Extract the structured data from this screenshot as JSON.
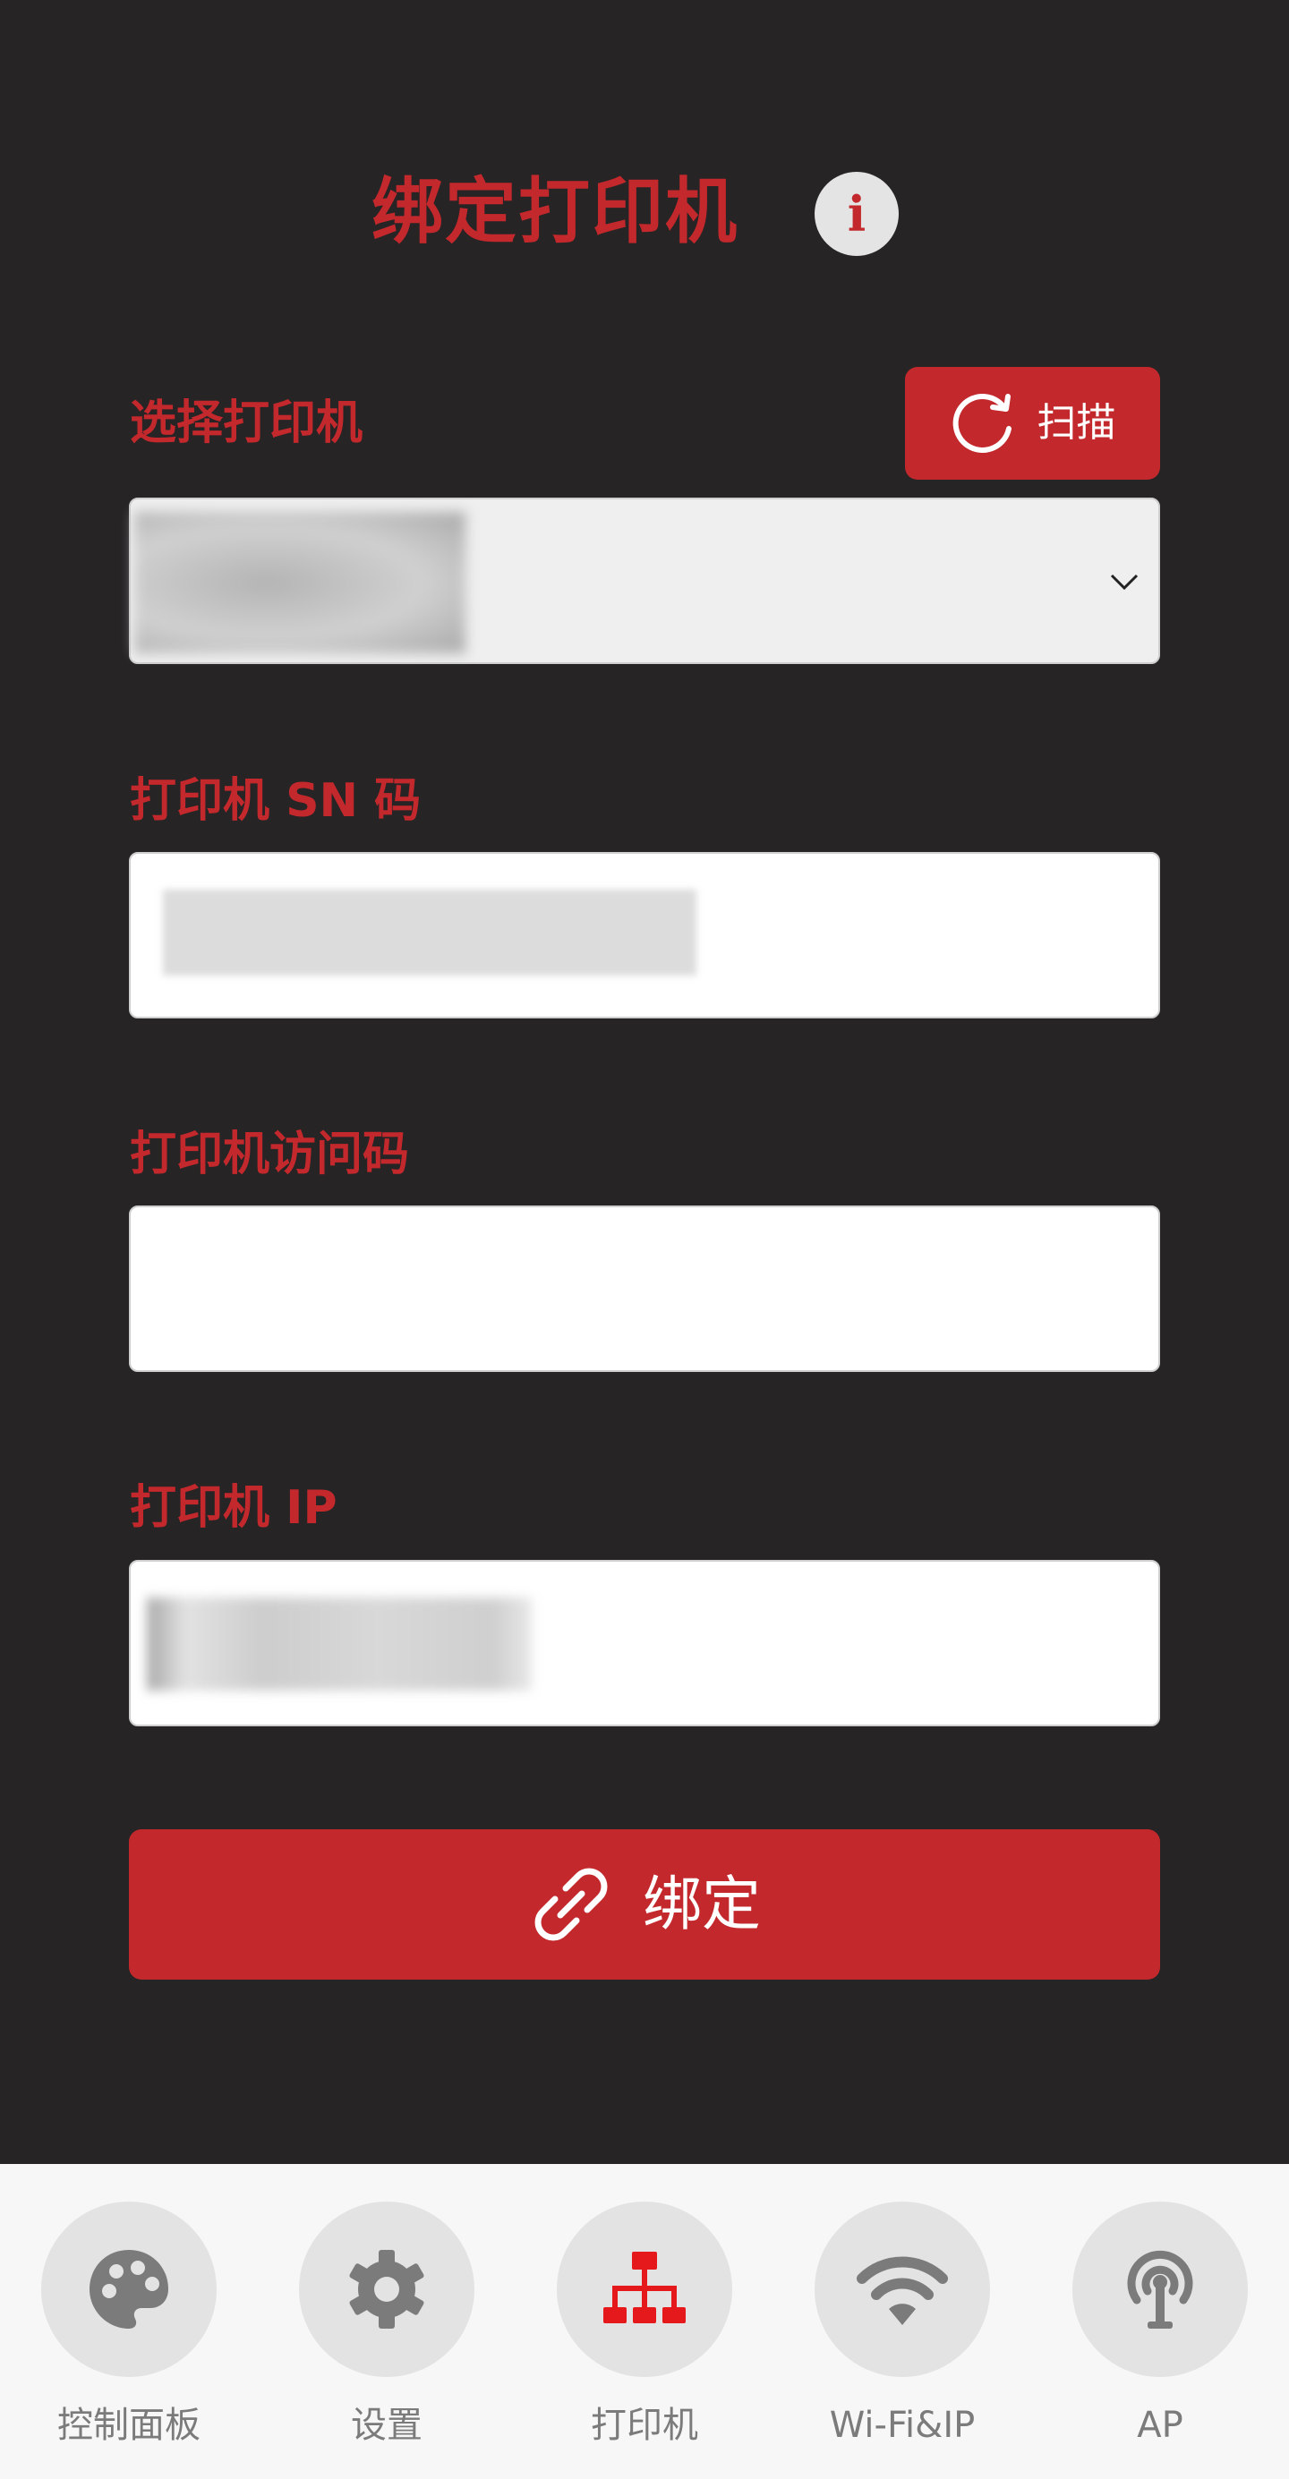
{
  "header": {
    "title": "绑定打印机"
  },
  "select_printer": {
    "label": "选择打印机",
    "scan_label": "扫描"
  },
  "sn": {
    "label": "打印机 SN 码"
  },
  "access_code": {
    "label": "打印机访问码",
    "value": ""
  },
  "ip": {
    "label": "打印机 IP"
  },
  "bind_button": {
    "label": "绑定"
  },
  "nav": {
    "items": [
      {
        "label": "控制面板",
        "icon": "palette-icon",
        "active": false
      },
      {
        "label": "设置",
        "icon": "gear-icon",
        "active": false
      },
      {
        "label": "打印机",
        "icon": "printer-network-icon",
        "active": true
      },
      {
        "label": "Wi-Fi&IP",
        "icon": "wifi-icon",
        "active": false
      },
      {
        "label": "AP",
        "icon": "broadcast-icon",
        "active": false
      }
    ]
  },
  "colors": {
    "accent": "#c3282c",
    "background": "#262425",
    "nav_bg": "#f7f7f7",
    "nav_circle": "#e3e3e3",
    "icon_gray": "#7b7b7b"
  }
}
